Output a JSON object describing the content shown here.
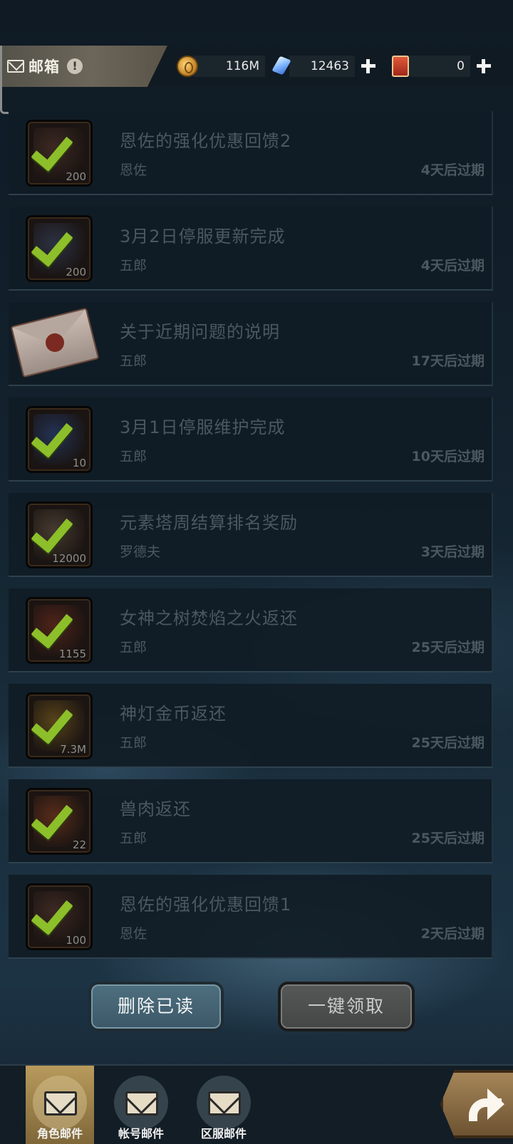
{
  "header": {
    "title": "邮箱",
    "warn_symbol": "!",
    "gold": "116M",
    "gems": "12463",
    "cards": "0",
    "plus": "+"
  },
  "mails": [
    {
      "title": "恩佐的强化优惠回馈2",
      "sender": "恩佐",
      "expire": "4天后过期",
      "qty": "200",
      "thumb": "box",
      "thumb_color": "#5a3a30"
    },
    {
      "title": "3月2日停服更新完成",
      "sender": "五郎",
      "expire": "4天后过期",
      "qty": "200",
      "thumb": "box",
      "thumb_color": "#3a4a6a"
    },
    {
      "title": "关于近期问题的说明",
      "sender": "五郎",
      "expire": "17天后过期",
      "qty": "",
      "thumb": "envelope",
      "thumb_color": ""
    },
    {
      "title": "3月1日停服维护完成",
      "sender": "五郎",
      "expire": "10天后过期",
      "qty": "10",
      "thumb": "box",
      "thumb_color": "#2a4a8a"
    },
    {
      "title": "元素塔周结算排名奖励",
      "sender": "罗德夫",
      "expire": "3天后过期",
      "qty": "12000",
      "thumb": "box",
      "thumb_color": "#6a5a48"
    },
    {
      "title": "女神之树焚焰之火返还",
      "sender": "五郎",
      "expire": "25天后过期",
      "qty": "1155",
      "thumb": "box",
      "thumb_color": "#7a3020"
    },
    {
      "title": "神灯金币返还",
      "sender": "五郎",
      "expire": "25天后过期",
      "qty": "7.3M",
      "thumb": "box",
      "thumb_color": "#8a6a20"
    },
    {
      "title": "兽肉返还",
      "sender": "五郎",
      "expire": "25天后过期",
      "qty": "22",
      "thumb": "box",
      "thumb_color": "#8a4020"
    },
    {
      "title": "恩佐的强化优惠回馈1",
      "sender": "恩佐",
      "expire": "2天后过期",
      "qty": "100",
      "thumb": "box",
      "thumb_color": "#5a3a30"
    }
  ],
  "actions": {
    "delete_read": "删除已读",
    "claim_all": "一键领取"
  },
  "tabs": [
    {
      "label": "角色邮件",
      "active": true
    },
    {
      "label": "帐号邮件",
      "active": false
    },
    {
      "label": "区服邮件",
      "active": false
    }
  ]
}
